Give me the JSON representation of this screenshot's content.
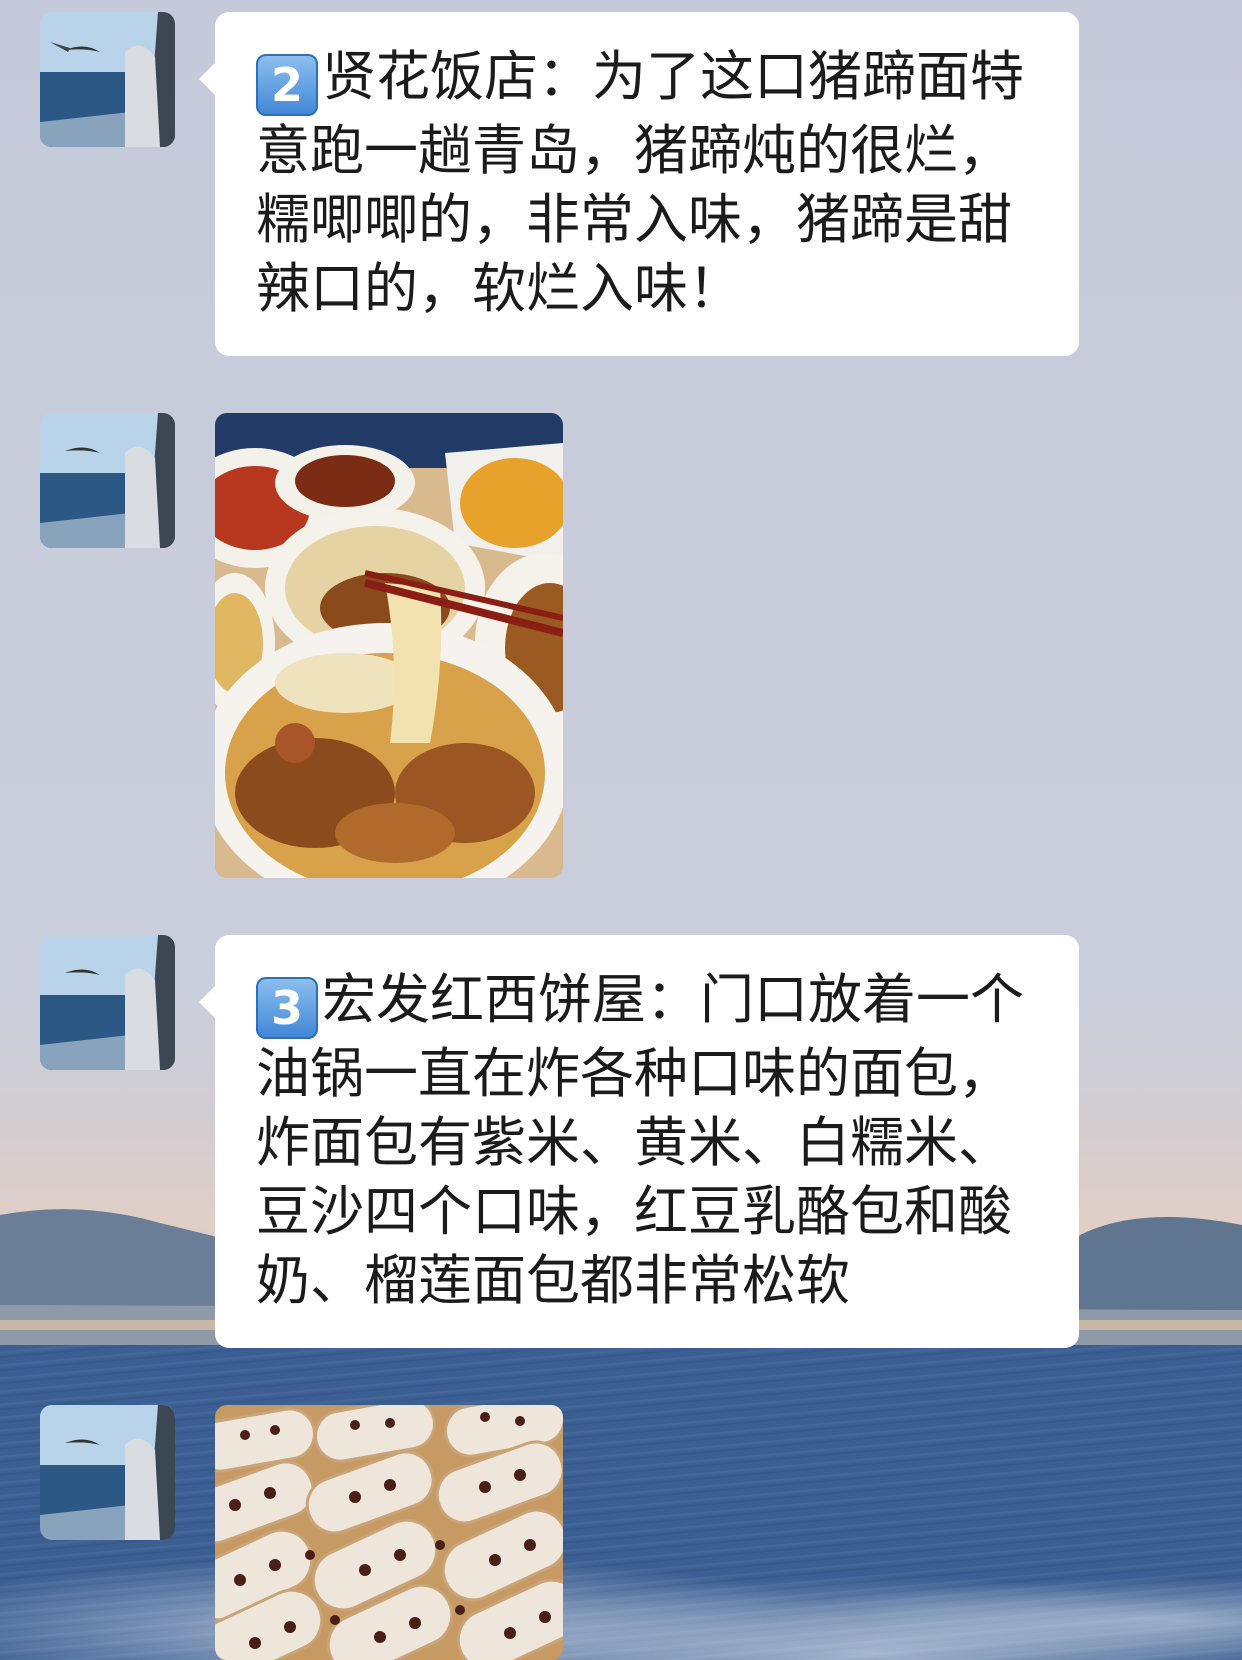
{
  "messages": [
    {
      "type": "text",
      "number": "2",
      "text": "贤花饭店：为了这口猪蹄面特意跑一趟青岛，猪蹄炖的很烂，糯唧唧的，非常入味，猪蹄是甜辣口的，软烂入味！"
    },
    {
      "type": "image",
      "subject": "pig-trotter-noodles"
    },
    {
      "type": "text",
      "number": "3",
      "text": "宏发红西饼屋：门口放着一个油锅一直在炸各种口味的面包，炸面包有紫米、黄米、白糯米、豆沙四个口味，红豆乳酪包和酸奶、榴莲面包都非常松软"
    },
    {
      "type": "image",
      "subject": "red-bean-bread"
    }
  ],
  "colors": {
    "bubble": "#ffffff",
    "text": "#1b1b1b",
    "badge": "#3f86d6"
  },
  "icons": {
    "avatar": "avatar-seagull-sea",
    "badge": "keycap-number-icon"
  }
}
